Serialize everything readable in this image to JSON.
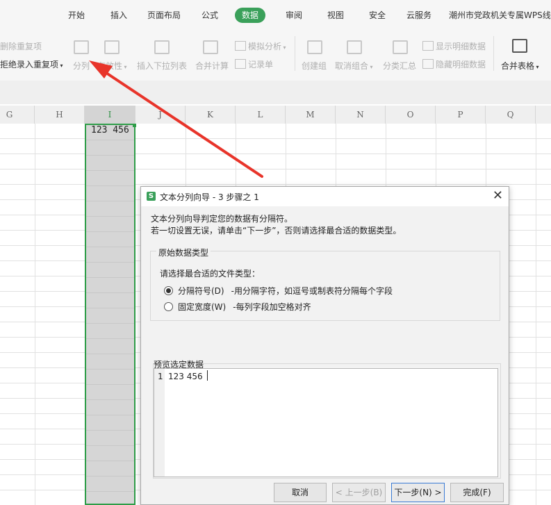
{
  "ribbon": {
    "tabs": [
      "开始",
      "插入",
      "页面布局",
      "公式",
      "数据",
      "审阅",
      "视图",
      "安全",
      "云服务",
      "潮州市党政机关专属WPS线"
    ],
    "active_tab": "数据",
    "left_items": [
      "删除重复项",
      "拒绝录入重复项"
    ],
    "tools": {
      "split": "分列",
      "validity": "有效性",
      "dropdown": "插入下拉列表",
      "merge_calc": "合并计算",
      "simulate": "模拟分析",
      "record": "记录单",
      "create_group": "创建组",
      "ungroup": "取消组合",
      "subtotal": "分类汇总",
      "show_detail": "显示明细数据",
      "hide_detail": "隐藏明细数据",
      "merge_table": "合并表格"
    }
  },
  "sheet": {
    "columns": [
      "G",
      "H",
      "I",
      "J",
      "K",
      "L",
      "M",
      "N",
      "O",
      "P",
      "Q"
    ],
    "selected_column": "I",
    "cell_value": "123 456"
  },
  "dialog": {
    "title": "文本分列向导 - 3 步骤之 1",
    "intro_line1": "文本分列向导判定您的数据有分隔符。",
    "intro_line2": "若一切设置无误，请单击“下一步”，否则请选择最合适的数据类型。",
    "group_label": "原始数据类型",
    "choose_label": "请选择最合适的文件类型：",
    "options": [
      {
        "label": "分隔符号(D)",
        "desc": "-用分隔字符，如逗号或制表符分隔每个字段",
        "selected": true
      },
      {
        "label": "固定宽度(W)",
        "desc": "-每列字段加空格对齐",
        "selected": false
      }
    ],
    "preview_label": "预览选定数据",
    "preview_line_number": "1",
    "preview_line": "123 456",
    "buttons": {
      "cancel": "取消",
      "prev": "< 上一步(B)",
      "next": "下一步(N) >",
      "finish": "完成(F)"
    }
  },
  "colors": {
    "accent_green": "#3aa05a",
    "arrow_red": "#e8342a"
  }
}
